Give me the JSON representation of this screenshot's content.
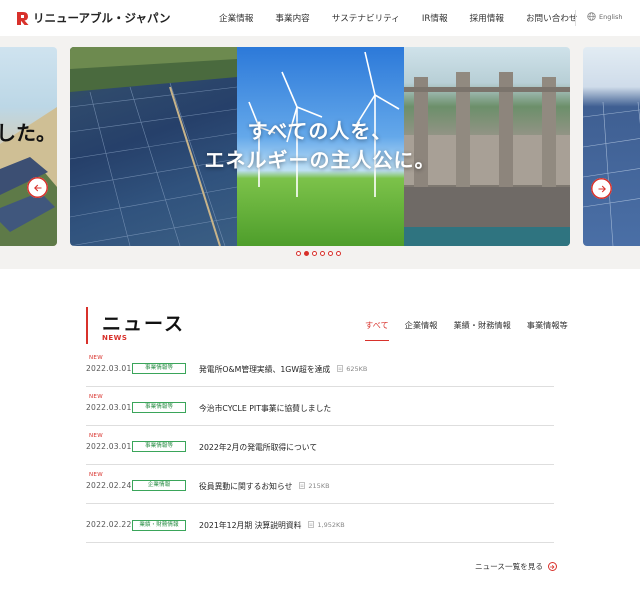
{
  "header": {
    "brand": "リニューアブル・ジャパン",
    "nav": [
      "企業情報",
      "事業内容",
      "サステナビリティ",
      "IR情報",
      "採用情報",
      "お問い合わせ"
    ],
    "lang": "English"
  },
  "hero": {
    "copy_line1": "すべての人を、",
    "copy_line2": "エネルギーの主人公に。",
    "prev_slide_text": "した。",
    "dots_total": 6,
    "dots_active": 2
  },
  "news": {
    "title": "ニュース",
    "subtitle": "NEWS",
    "tabs": [
      "すべて",
      "企業情報",
      "業績・財務情報",
      "事業情報等"
    ],
    "active_tab": "すべて",
    "items": [
      {
        "new": "NEW",
        "date": "2022.03.01",
        "category": "事業情報等",
        "title": "発電所O&M管理実績、1GW超を達成",
        "size": "625KB"
      },
      {
        "new": "NEW",
        "date": "2022.03.01",
        "category": "事業情報等",
        "title": "今治市CYCLE PIT事業に協賛しました",
        "size": ""
      },
      {
        "new": "NEW",
        "date": "2022.03.01",
        "category": "事業情報等",
        "title": "2022年2月の発電所取得について",
        "size": ""
      },
      {
        "new": "NEW",
        "date": "2022.02.24",
        "category": "企業情報",
        "title": "役員異動に関するお知らせ",
        "size": "215KB"
      },
      {
        "new": "",
        "date": "2022.02.22",
        "category": "業績・財務情報",
        "title": "2021年12月期 決算説明資料",
        "size": "1,952KB"
      }
    ],
    "more": "ニュース一覧を見る"
  },
  "colors": {
    "accent": "#d8312b",
    "category": "#3aa55a"
  }
}
